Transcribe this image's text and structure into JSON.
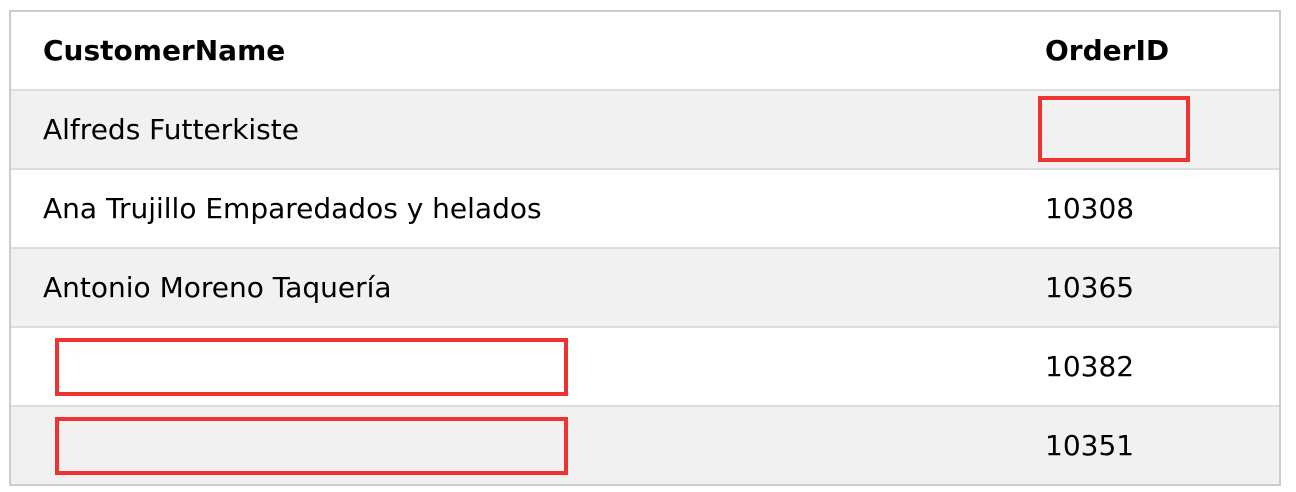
{
  "table": {
    "headers": {
      "customer_name": "CustomerName",
      "order_id": "OrderID"
    },
    "rows": [
      {
        "customer_name": "Alfreds Futterkiste",
        "order_id": "",
        "order_id_redacted": true,
        "customer_name_redacted": false
      },
      {
        "customer_name": "Ana Trujillo Emparedados y helados",
        "order_id": "10308",
        "order_id_redacted": false,
        "customer_name_redacted": false
      },
      {
        "customer_name": "Antonio Moreno Taquería",
        "order_id": "10365",
        "order_id_redacted": false,
        "customer_name_redacted": false
      },
      {
        "customer_name": "",
        "order_id": "10382",
        "order_id_redacted": false,
        "customer_name_redacted": true
      },
      {
        "customer_name": "",
        "order_id": "10351",
        "order_id_redacted": false,
        "customer_name_redacted": true
      }
    ]
  },
  "colors": {
    "shaded_row": "#f1f1f1",
    "border": "#dddddd",
    "redaction_box": "#ee3333"
  }
}
